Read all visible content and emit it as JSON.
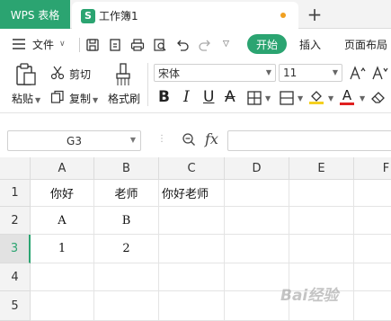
{
  "tabs": {
    "app_tab": "WPS 表格",
    "doc_tab": "工作簿1",
    "doc_logo": "S",
    "new_tab": "+"
  },
  "menu": {
    "file": "文件",
    "start": "开始",
    "insert": "插入",
    "page_layout": "页面布局",
    "menu_icon": "hamburger-icon"
  },
  "ribbon": {
    "paste": "粘贴",
    "cut": "剪切",
    "copy": "复制",
    "format_painter": "格式刷",
    "font_name": "宋体",
    "font_size": "11"
  },
  "formula_bar": {
    "name_box": "G3",
    "fx": "fx"
  },
  "sheet": {
    "columns": [
      "A",
      "B",
      "C",
      "D",
      "E",
      "F"
    ],
    "rows": [
      "1",
      "2",
      "3",
      "4",
      "5"
    ],
    "active_row": "3",
    "cells": {
      "A1": "你好",
      "B1": "老师",
      "C1": "你好老师",
      "A2": "A",
      "B2": "B",
      "A3": "1",
      "B3": "2"
    }
  },
  "watermark": "Bai经验",
  "colors": {
    "accent": "#2ba471",
    "font_color": "#e02020",
    "highlight": "#f5d020"
  }
}
